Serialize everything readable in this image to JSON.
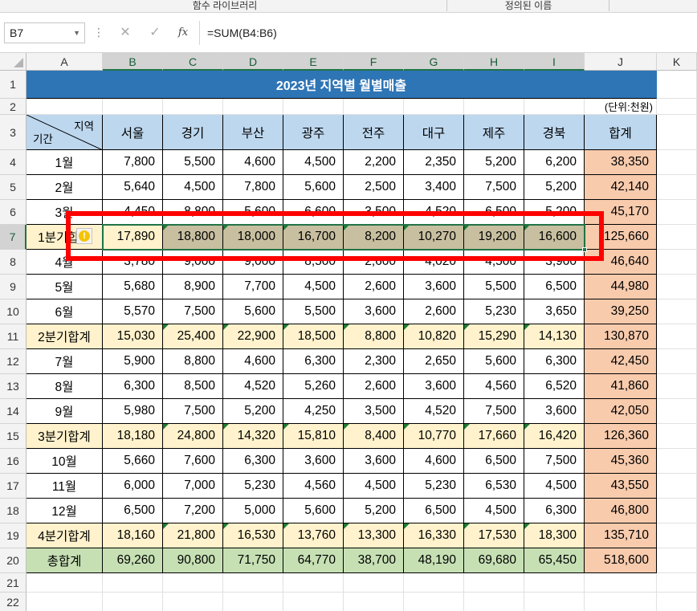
{
  "ribbon": {
    "groups": [
      "함수 라이브러리",
      "정의된 이름"
    ]
  },
  "formula_bar": {
    "name_box": "B7",
    "fx_label": "fx",
    "formula": "=SUM(B4:B6)"
  },
  "columns": [
    "A",
    "B",
    "C",
    "D",
    "E",
    "F",
    "G",
    "H",
    "I",
    "J",
    "K"
  ],
  "rows": [
    "1",
    "2",
    "3",
    "4",
    "5",
    "6",
    "7",
    "8",
    "9",
    "10",
    "11",
    "12",
    "13",
    "14",
    "15",
    "16",
    "17",
    "18",
    "19",
    "20",
    "21",
    "22"
  ],
  "sheet": {
    "title": "2023년 지역별 월별매출",
    "unit": "(단위:천원)",
    "header_region": "지역",
    "header_period": "기간",
    "headers": [
      "서울",
      "경기",
      "부산",
      "광주",
      "전주",
      "대구",
      "제주",
      "경북",
      "합계"
    ],
    "data": [
      [
        "1월",
        "7,800",
        "5,500",
        "4,600",
        "4,500",
        "2,200",
        "2,350",
        "5,200",
        "6,200",
        "38,350"
      ],
      [
        "2월",
        "5,640",
        "4,500",
        "7,800",
        "5,600",
        "2,500",
        "3,400",
        "7,500",
        "5,200",
        "42,140"
      ],
      [
        "3월",
        "4,450",
        "8,800",
        "5,600",
        "6,600",
        "3,500",
        "4,520",
        "6,500",
        "5,200",
        "45,170"
      ],
      [
        "1분기합계",
        "17,890",
        "18,800",
        "18,000",
        "16,700",
        "8,200",
        "10,270",
        "19,200",
        "16,600",
        "125,660"
      ],
      [
        "4월",
        "3,780",
        "9,000",
        "9,000",
        "8,500",
        "2,600",
        "4,020",
        "4,500",
        "3,900",
        "46,640"
      ],
      [
        "5월",
        "5,680",
        "8,900",
        "7,700",
        "4,500",
        "2,600",
        "3,600",
        "5,500",
        "6,500",
        "44,980"
      ],
      [
        "6월",
        "5,570",
        "7,500",
        "5,600",
        "5,500",
        "3,600",
        "2,600",
        "5,230",
        "3,650",
        "39,250"
      ],
      [
        "2분기합계",
        "15,030",
        "25,400",
        "22,900",
        "18,500",
        "8,800",
        "10,820",
        "15,290",
        "14,130",
        "130,870"
      ],
      [
        "7월",
        "5,900",
        "8,800",
        "4,600",
        "6,300",
        "2,300",
        "2,650",
        "5,600",
        "6,300",
        "42,450"
      ],
      [
        "8월",
        "6,300",
        "8,500",
        "4,520",
        "5,260",
        "2,600",
        "3,600",
        "4,560",
        "6,520",
        "41,860"
      ],
      [
        "9월",
        "5,980",
        "7,500",
        "5,200",
        "4,250",
        "3,500",
        "4,520",
        "7,500",
        "3,600",
        "42,050"
      ],
      [
        "3분기합계",
        "18,180",
        "24,800",
        "14,320",
        "15,810",
        "8,400",
        "10,770",
        "17,660",
        "16,420",
        "126,360"
      ],
      [
        "10월",
        "5,660",
        "7,600",
        "6,300",
        "3,600",
        "3,600",
        "4,600",
        "6,500",
        "7,500",
        "45,360"
      ],
      [
        "11월",
        "6,000",
        "7,000",
        "5,230",
        "4,560",
        "4,500",
        "5,230",
        "6,530",
        "4,500",
        "43,550"
      ],
      [
        "12월",
        "6,500",
        "7,200",
        "5,000",
        "5,600",
        "5,200",
        "6,500",
        "4,500",
        "6,300",
        "46,800"
      ],
      [
        "4분기합계",
        "18,160",
        "21,800",
        "16,530",
        "13,760",
        "13,300",
        "16,330",
        "17,530",
        "18,300",
        "135,710"
      ],
      [
        "총합계",
        "69,260",
        "90,800",
        "71,750",
        "64,770",
        "38,700",
        "48,190",
        "69,680",
        "65,450",
        "518,600"
      ]
    ]
  },
  "colors": {
    "title_bg": "#2e75b6",
    "header_bg": "#bdd7ee",
    "quarter_bg": "#fff2cc",
    "total_bg": "#c6e0b4",
    "sum_col_bg": "#f8cbad",
    "selection_bg": "#c7bfa0",
    "selection_border": "#217346",
    "annotation_red": "#ff0000"
  },
  "icons": {
    "error_indicator": "warning-icon",
    "name_box_dropdown": "chevron-down-icon",
    "cancel": "close-icon",
    "enter": "check-icon",
    "function": "fx-icon"
  }
}
